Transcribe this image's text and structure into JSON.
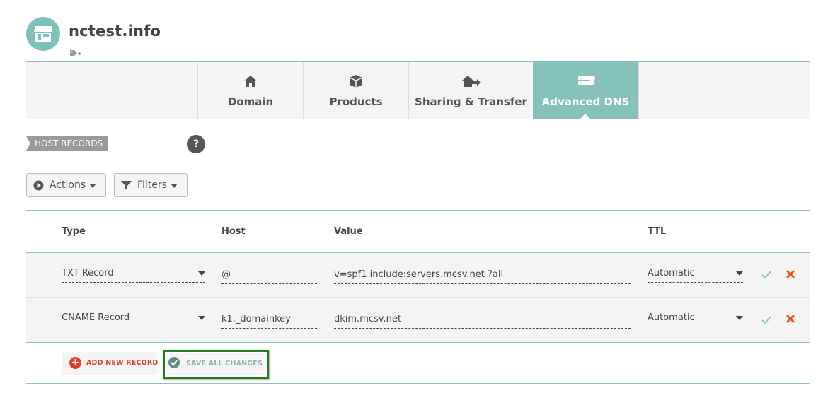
{
  "header": {
    "domain_name": "nctest.info",
    "avatar_icon": "storefront-icon",
    "tag_icon": "tag-add-icon"
  },
  "tabs": [
    {
      "label": "Domain",
      "icon": "house-icon",
      "active": false
    },
    {
      "label": "Products",
      "icon": "box-icon",
      "active": false
    },
    {
      "label": "Sharing & Transfer",
      "icon": "house-transfer-icon",
      "active": false
    },
    {
      "label": "Advanced DNS",
      "icon": "server-icon",
      "active": true
    }
  ],
  "section": {
    "label": "HOST RECORDS",
    "help": "?"
  },
  "toolbar": {
    "actions_label": "Actions",
    "filters_label": "Filters"
  },
  "table": {
    "columns": [
      "Type",
      "Host",
      "Value",
      "TTL"
    ],
    "rows": [
      {
        "type": "TXT Record",
        "host": "@",
        "value": "v=spf1 include:servers.mcsv.net ?all",
        "ttl": "Automatic"
      },
      {
        "type": "CNAME Record",
        "host": "k1._domainkey",
        "value": "dkim.mcsv.net",
        "ttl": "Automatic"
      }
    ]
  },
  "footer": {
    "add_label": "ADD NEW RECORD",
    "save_label": "SAVE ALL CHANGES"
  },
  "colors": {
    "accent": "#86c1bb",
    "danger": "#e0402a",
    "highlight_border": "#1e7d1e"
  }
}
